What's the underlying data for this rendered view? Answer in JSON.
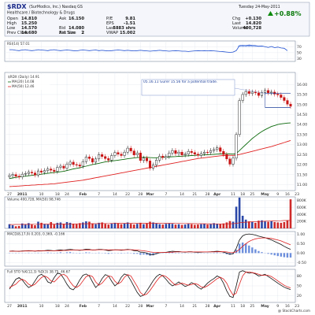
{
  "header": {
    "symbol": "$RDX",
    "company": "(SurModics, Inc.)  Nasdaq GS",
    "sector": "Healthcare / Biotechnology & Drugs",
    "date_text": "Tuesday 24-May-2011",
    "change_pct": "+0.88%",
    "watermark": "@ StockCharts.com",
    "stats": [
      {
        "label": "Open",
        "value": "14.810"
      },
      {
        "label": "High",
        "value": "15.250"
      },
      {
        "label": "Low",
        "value": "14.570"
      },
      {
        "label": "Prev Close",
        "value": "14.680"
      },
      {
        "label": "Ask",
        "value": "16.150"
      },
      {
        "label": "Ask Size",
        "value": "2"
      },
      {
        "label": "Bid",
        "value": "14.080"
      },
      {
        "label": "Bid Size",
        "value": "2"
      },
      {
        "label": "P/E",
        "value": "9.81"
      },
      {
        "label": "EPS",
        "value": "-1.51"
      },
      {
        "label": "Last",
        "value": "5883 shrs"
      },
      {
        "label": "VWAP",
        "value": "15.002"
      },
      {
        "label": "Chg",
        "value": "+0.130"
      },
      {
        "label": "Last",
        "value": "14.820"
      },
      {
        "label": "Volume",
        "value": "400,728"
      }
    ]
  },
  "chart_data": [
    {
      "type": "line",
      "panel": "rsi",
      "title": "RSI(14) 57.01",
      "yticks": [
        70,
        50,
        30
      ],
      "values": [
        60,
        60,
        58,
        57,
        59,
        60,
        58,
        57,
        58,
        60,
        59,
        58,
        57,
        59,
        60,
        58,
        57,
        58,
        59,
        58,
        57,
        56,
        58,
        59,
        58,
        57,
        58,
        59,
        57,
        58,
        57,
        56,
        57,
        58,
        59,
        58,
        57,
        58,
        57,
        56,
        57,
        58,
        57,
        56,
        55,
        56,
        57,
        58,
        57,
        56,
        55,
        56,
        57,
        56,
        55,
        55,
        54,
        55,
        56,
        57,
        56,
        57,
        56,
        57,
        56,
        55,
        54,
        53,
        52,
        51,
        52,
        57,
        74,
        75,
        74,
        76,
        75,
        74,
        72,
        73,
        70,
        68,
        71,
        67,
        69,
        66,
        65,
        57
      ]
    },
    {
      "type": "candlestick",
      "panel": "price",
      "legend": [
        "$RDX (Daily) 14.91",
        "MA(20) 14.08",
        "MA(50) 12.46"
      ],
      "legend_colors": [
        "#000000",
        "#0d6b0d",
        "#e02020"
      ],
      "annotation": "05.16.11 Gurer 15.56 for a potential trade.",
      "annotation_color": "#1a3d9a",
      "ylim": [
        10.7,
        16.6
      ],
      "yticks": [
        16.0,
        15.5,
        15.0,
        14.5,
        14.0,
        13.5,
        13.0,
        12.5,
        12.0,
        11.5,
        11.0
      ],
      "xticks": [
        {
          "i": 0,
          "label": "27"
        },
        {
          "i": 4,
          "label": "2011"
        },
        {
          "i": 10,
          "label": "10"
        },
        {
          "i": 15,
          "label": "18"
        },
        {
          "i": 18,
          "label": "24"
        },
        {
          "i": 23,
          "label": "Feb"
        },
        {
          "i": 28,
          "label": "7"
        },
        {
          "i": 33,
          "label": "14"
        },
        {
          "i": 37,
          "label": "22"
        },
        {
          "i": 41,
          "label": "28"
        },
        {
          "i": 44,
          "label": "Mar"
        },
        {
          "i": 49,
          "label": "7"
        },
        {
          "i": 54,
          "label": "14"
        },
        {
          "i": 58,
          "label": "21"
        },
        {
          "i": 62,
          "label": "28"
        },
        {
          "i": 65,
          "label": "Apr"
        },
        {
          "i": 70,
          "label": "11"
        },
        {
          "i": 73,
          "label": "18"
        },
        {
          "i": 76,
          "label": "25"
        },
        {
          "i": 80,
          "label": "May"
        },
        {
          "i": 84,
          "label": "9"
        },
        {
          "i": 87,
          "label": "16"
        },
        {
          "i": 90,
          "label": "23"
        }
      ],
      "close": [
        11.45,
        11.5,
        11.42,
        11.38,
        11.52,
        11.55,
        11.62,
        11.58,
        11.48,
        11.68,
        11.62,
        11.7,
        11.78,
        11.72,
        11.66,
        11.86,
        11.92,
        11.82,
        12.02,
        12.12,
        12.0,
        11.98,
        11.92,
        12.15,
        12.38,
        12.3,
        12.12,
        12.28,
        12.5,
        12.4,
        12.3,
        12.22,
        12.45,
        12.6,
        12.52,
        12.45,
        12.62,
        12.82,
        12.68,
        12.48,
        12.58,
        12.2,
        12.32,
        12.18,
        11.82,
        11.98,
        12.22,
        12.42,
        12.35,
        12.4,
        12.58,
        12.7,
        12.55,
        12.62,
        12.48,
        12.52,
        12.66,
        12.6,
        12.52,
        12.46,
        12.55,
        12.62,
        12.6,
        12.7,
        12.75,
        12.84,
        12.66,
        12.5,
        12.28,
        12.02,
        12.32,
        13.5,
        15.2,
        15.5,
        15.65,
        15.55,
        15.62,
        15.58,
        15.45,
        15.6,
        15.7,
        15.58,
        15.62,
        15.52,
        15.48,
        15.35,
        15.2,
        15.02,
        14.91
      ],
      "ma20": [
        11.3,
        11.33,
        11.36,
        11.38,
        11.4,
        11.42,
        11.44,
        11.46,
        11.48,
        11.5,
        11.52,
        11.54,
        11.56,
        11.58,
        11.6,
        11.62,
        11.64,
        11.66,
        11.7,
        11.74,
        11.78,
        11.81,
        11.84,
        11.88,
        11.92,
        11.96,
        12.0,
        12.03,
        12.06,
        12.1,
        12.13,
        12.16,
        12.18,
        12.2,
        12.22,
        12.24,
        12.26,
        12.29,
        12.31,
        12.33,
        12.35,
        12.36,
        12.36,
        12.36,
        12.35,
        12.34,
        12.34,
        12.35,
        12.36,
        12.37,
        12.38,
        12.39,
        12.4,
        12.41,
        12.42,
        12.43,
        12.44,
        12.45,
        12.46,
        12.47,
        12.47,
        12.48,
        12.49,
        12.5,
        12.51,
        12.52,
        12.53,
        12.54,
        12.54,
        12.53,
        12.52,
        12.55,
        12.7,
        12.85,
        13.0,
        13.15,
        13.3,
        13.42,
        13.54,
        13.65,
        13.74,
        13.82,
        13.9,
        13.95,
        14.0,
        14.03,
        14.05,
        14.07,
        14.08
      ],
      "ma50": [
        10.9,
        10.91,
        10.92,
        10.93,
        10.94,
        10.95,
        10.96,
        10.97,
        10.98,
        10.99,
        11.0,
        11.01,
        11.02,
        11.03,
        11.04,
        11.06,
        11.08,
        11.1,
        11.12,
        11.14,
        11.16,
        11.18,
        11.2,
        11.22,
        11.25,
        11.28,
        11.31,
        11.34,
        11.37,
        11.4,
        11.43,
        11.46,
        11.49,
        11.52,
        11.55,
        11.58,
        11.61,
        11.64,
        11.67,
        11.7,
        11.73,
        11.76,
        11.79,
        11.82,
        11.85,
        11.88,
        11.91,
        11.94,
        11.97,
        12.0,
        12.03,
        12.06,
        12.09,
        12.12,
        12.15,
        12.18,
        12.21,
        12.24,
        12.27,
        12.3,
        12.32,
        12.34,
        12.36,
        12.38,
        12.4,
        12.42,
        12.44,
        12.45,
        12.46,
        12.46,
        12.46,
        12.47,
        12.5,
        12.54,
        12.58,
        12.62,
        12.66,
        12.7,
        12.74,
        12.78,
        12.82,
        12.86,
        12.9,
        12.95,
        13.0,
        13.05,
        13.1,
        13.15,
        13.2
      ]
    },
    {
      "type": "bar",
      "panel": "volume",
      "title": "Volume 400,728, MA(50) 98,746",
      "yticks": [
        "800K",
        "600K",
        "400K",
        "200K"
      ],
      "ylim": [
        0,
        900
      ],
      "values": [
        120,
        90,
        60,
        70,
        140,
        110,
        150,
        110,
        90,
        190,
        160,
        130,
        120,
        180,
        110,
        160,
        170,
        120,
        180,
        160,
        130,
        120,
        150,
        170,
        200,
        190,
        140,
        120,
        160,
        170,
        130,
        110,
        140,
        160,
        150,
        120,
        140,
        170,
        130,
        110,
        130,
        160,
        120,
        140,
        190,
        170,
        140,
        120,
        110,
        130,
        150,
        130,
        110,
        120,
        100,
        110,
        130,
        120,
        100,
        110,
        120,
        130,
        110,
        120,
        150,
        130,
        120,
        140,
        170,
        210,
        190,
        620,
        880,
        360,
        250,
        200,
        180,
        160,
        220,
        230,
        200,
        190,
        210,
        180,
        170,
        160,
        180,
        230,
        830
      ],
      "ma": [
        110,
        111,
        112,
        112,
        113,
        114,
        115,
        116,
        117,
        118,
        119,
        120,
        121,
        122,
        123,
        124,
        125,
        126,
        127,
        128,
        129,
        130,
        131,
        132,
        133,
        134,
        135,
        136,
        137,
        138,
        139,
        140,
        141,
        142,
        143,
        144,
        145,
        146,
        147,
        148,
        148,
        148,
        148,
        148,
        148,
        148,
        148,
        147,
        146,
        145,
        144,
        143,
        142,
        141,
        140,
        139,
        138,
        137,
        136,
        135,
        134,
        133,
        132,
        131,
        130,
        129,
        129,
        130,
        131,
        133,
        135,
        145,
        160,
        170,
        178,
        183,
        188,
        192,
        197,
        201,
        205,
        209,
        212,
        215,
        218,
        221,
        224,
        226,
        230
      ]
    },
    {
      "type": "line",
      "panel": "macd",
      "title": "MACD(8,17,9) 0.203, 0.369, -0.166",
      "yticks": [
        "1.00",
        "0.50",
        "0.00",
        "-0.50"
      ],
      "ylim": [
        -0.7,
        1.15
      ],
      "macd": [
        0.1,
        0.11,
        0.1,
        0.09,
        0.11,
        0.12,
        0.13,
        0.12,
        0.1,
        0.13,
        0.12,
        0.13,
        0.15,
        0.14,
        0.12,
        0.15,
        0.17,
        0.15,
        0.18,
        0.2,
        0.18,
        0.16,
        0.14,
        0.17,
        0.21,
        0.2,
        0.16,
        0.17,
        0.2,
        0.19,
        0.16,
        0.13,
        0.15,
        0.18,
        0.17,
        0.15,
        0.17,
        0.2,
        0.18,
        0.13,
        0.12,
        0.05,
        0.04,
        0.0,
        -0.08,
        -0.08,
        -0.03,
        0.02,
        0.03,
        0.04,
        0.07,
        0.1,
        0.08,
        0.08,
        0.06,
        0.05,
        0.07,
        0.07,
        0.05,
        0.04,
        0.05,
        0.06,
        0.06,
        0.07,
        0.08,
        0.1,
        0.08,
        0.05,
        0.0,
        -0.06,
        -0.03,
        0.25,
        0.7,
        0.92,
        1.0,
        1.02,
        1.0,
        0.96,
        0.9,
        0.86,
        0.82,
        0.76,
        0.7,
        0.62,
        0.54,
        0.46,
        0.36,
        0.27,
        0.2
      ],
      "signal": [
        0.1,
        0.1,
        0.1,
        0.1,
        0.1,
        0.11,
        0.11,
        0.11,
        0.11,
        0.11,
        0.11,
        0.12,
        0.12,
        0.12,
        0.12,
        0.13,
        0.13,
        0.14,
        0.14,
        0.15,
        0.16,
        0.16,
        0.16,
        0.16,
        0.17,
        0.17,
        0.17,
        0.17,
        0.18,
        0.18,
        0.18,
        0.17,
        0.17,
        0.17,
        0.17,
        0.17,
        0.17,
        0.18,
        0.18,
        0.17,
        0.16,
        0.14,
        0.12,
        0.1,
        0.06,
        0.04,
        0.03,
        0.03,
        0.03,
        0.03,
        0.04,
        0.05,
        0.06,
        0.06,
        0.06,
        0.06,
        0.06,
        0.06,
        0.06,
        0.06,
        0.06,
        0.06,
        0.06,
        0.06,
        0.06,
        0.07,
        0.07,
        0.07,
        0.06,
        0.03,
        0.02,
        0.07,
        0.2,
        0.36,
        0.5,
        0.62,
        0.7,
        0.76,
        0.79,
        0.81,
        0.81,
        0.8,
        0.78,
        0.74,
        0.7,
        0.65,
        0.58,
        0.51,
        0.44
      ]
    },
    {
      "type": "line",
      "panel": "stoch",
      "title": "Full STO %K(12,3) %D(3) 38.75, 46.67",
      "yticks": [
        80,
        50,
        20
      ],
      "k": [
        40,
        55,
        70,
        75,
        68,
        55,
        45,
        50,
        65,
        80,
        85,
        78,
        62,
        58,
        75,
        88,
        86,
        72,
        55,
        42,
        38,
        50,
        68,
        82,
        86,
        80,
        62,
        45,
        55,
        72,
        84,
        80,
        64,
        50,
        58,
        76,
        86,
        82,
        66,
        48,
        30,
        18,
        22,
        35,
        50,
        66,
        78,
        85,
        80,
        70,
        58,
        50,
        55,
        62,
        55,
        48,
        52,
        60,
        55,
        46,
        40,
        48,
        58,
        66,
        72,
        80,
        75,
        58,
        35,
        18,
        15,
        50,
        92,
        96,
        92,
        88,
        90,
        86,
        80,
        82,
        85,
        78,
        72,
        65,
        58,
        52,
        46,
        42,
        39
      ],
      "d": [
        45,
        50,
        55,
        65,
        70,
        65,
        55,
        50,
        55,
        65,
        75,
        80,
        75,
        65,
        62,
        72,
        82,
        85,
        78,
        62,
        50,
        45,
        52,
        65,
        78,
        82,
        78,
        62,
        52,
        58,
        70,
        80,
        78,
        64,
        56,
        62,
        76,
        84,
        80,
        64,
        48,
        30,
        22,
        25,
        36,
        50,
        64,
        76,
        82,
        78,
        70,
        60,
        52,
        55,
        58,
        55,
        52,
        54,
        57,
        54,
        47,
        45,
        50,
        57,
        64,
        72,
        76,
        71,
        58,
        38,
        22,
        28,
        55,
        80,
        92,
        92,
        90,
        88,
        85,
        82,
        82,
        82,
        78,
        72,
        65,
        58,
        52,
        47,
        44
      ]
    }
  ]
}
